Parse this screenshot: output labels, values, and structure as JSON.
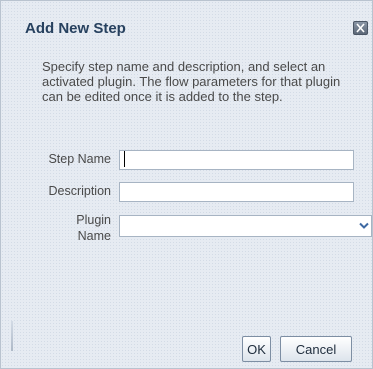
{
  "dialog": {
    "title": "Add New Step",
    "instructions": "Specify step name and description, and select an activated plugin. The flow parameters for that plugin can be edited once it is added to the step."
  },
  "form": {
    "step_name_label": "Step Name",
    "step_name_value": "",
    "description_label": "Description",
    "description_value": "",
    "plugin_label_line1": "Plugin",
    "plugin_label_line2": "Name",
    "plugin_selected": ""
  },
  "buttons": {
    "ok_label": "OK",
    "cancel_label": "Cancel"
  },
  "icons": {
    "close": "close-icon",
    "dropdown": "chevron-down-icon"
  },
  "colors": {
    "title": "#27415f",
    "background": "#e6ebf2",
    "border": "#a7b4c3"
  }
}
